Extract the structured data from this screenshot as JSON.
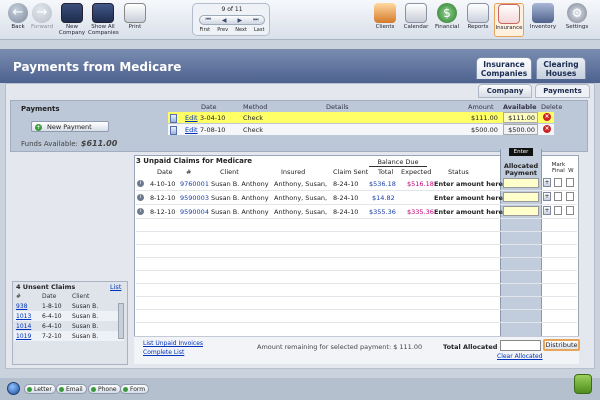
{
  "toolbar": {
    "back": "Back",
    "forward": "Forward",
    "new_company": "New Company",
    "show_all": "Show All Companies",
    "print": "Print",
    "nav_count": "9 of 11",
    "nav_first": "First",
    "nav_prev": "Prev",
    "nav_next": "Next",
    "nav_last": "Last",
    "clients": "Clients",
    "calendar": "Calendar",
    "financial": "Financial",
    "reports": "Reports",
    "insurance": "Insurance",
    "inventory": "Inventory",
    "settings": "Settings"
  },
  "title": "Payments from Medicare",
  "top_tabs": {
    "insurance_companies": "Insurance Companies",
    "clearing_houses": "Clearing Houses"
  },
  "sub_tabs": {
    "company": "Company",
    "payments": "Payments"
  },
  "payments": {
    "label": "Payments",
    "new_button": "New Payment",
    "funds_label": "Funds Available:",
    "funds_value": "$611.00",
    "headers": {
      "date": "Date",
      "method": "Method",
      "details": "Details",
      "amount": "Amount",
      "available": "Available",
      "delete": "Delete"
    },
    "rows": [
      {
        "edit": "Edit",
        "date": "3-04-10",
        "method": "Check",
        "amount": "$111.00",
        "available": "$111.00"
      },
      {
        "edit": "Edit",
        "date": "7-08-10",
        "method": "Check",
        "amount": "$500.00",
        "available": "$500.00"
      }
    ]
  },
  "claims": {
    "title": "3 Unpaid Claims for Medicare",
    "balance_due": "Balance Due",
    "headers": {
      "date": "Date",
      "num": "#",
      "client": "Client",
      "insured": "Insured",
      "claim_sent": "Claim Sent",
      "total": "Total",
      "expected": "Expected",
      "status": "Status"
    },
    "enter_tag": "Enter",
    "allocated_header": "Allocated Payment",
    "mark_header": "Mark Final",
    "w_header": "W",
    "rows": [
      {
        "date": "4-10-10",
        "num": "9760001",
        "client": "Susan B. Anthony",
        "insured": "Anthony, Susan,",
        "claim_sent": "8-24-10",
        "total": "$536.18",
        "expected": "$516.18",
        "status": "Enter amount here ->"
      },
      {
        "date": "8-12-10",
        "num": "9590003",
        "client": "Susan B. Anthony",
        "insured": "Anthony, Susan,",
        "claim_sent": "8-24-10",
        "total": "$14.82",
        "expected": "",
        "status": "Enter amount here ->"
      },
      {
        "date": "8-12-10",
        "num": "9590004",
        "client": "Susan B. Anthony",
        "insured": "Anthony, Susan,",
        "claim_sent": "8-24-10",
        "total": "$355.36",
        "expected": "$335.36",
        "status": "Enter amount here ->"
      }
    ],
    "list_unpaid": "List Unpaid Invoices",
    "complete_list": "Complete List",
    "remaining": "Amount remaining for selected payment: $ 111.00",
    "total_allocated": "Total Allocated",
    "clear_allocated": "Clear Allocated",
    "distribute": "Distribute"
  },
  "unsent": {
    "title": "4 Unsent Claims",
    "list_link": "List",
    "headers": {
      "num": "#",
      "date": "Date",
      "client": "Client"
    },
    "rows": [
      {
        "num": "938",
        "date": "1-8-10",
        "client": "Susan B."
      },
      {
        "num": "1013",
        "date": "6-4-10",
        "client": "Susan B."
      },
      {
        "num": "1014",
        "date": "6-4-10",
        "client": "Susan B."
      },
      {
        "num": "1019",
        "date": "7-2-10",
        "client": "Susan B."
      }
    ]
  },
  "bottom": {
    "letter": "Letter",
    "email": "Email",
    "phone": "Phone",
    "form": "Form"
  }
}
